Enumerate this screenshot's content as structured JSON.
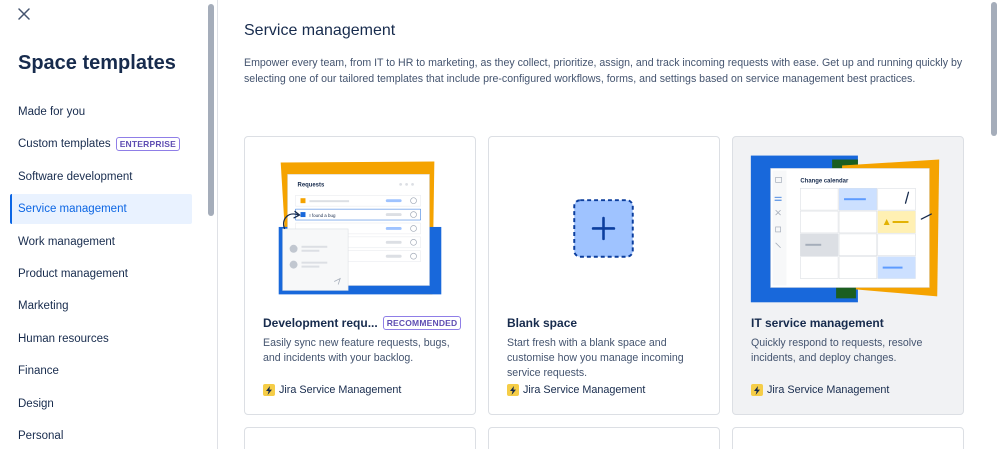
{
  "sidebar": {
    "title": "Space templates",
    "items": [
      {
        "label": "Made for you"
      },
      {
        "label": "Custom templates",
        "badge": "ENTERPRISE"
      },
      {
        "label": "Software development"
      },
      {
        "label": "Service management",
        "active": true
      },
      {
        "label": "Work management"
      },
      {
        "label": "Product management"
      },
      {
        "label": "Marketing"
      },
      {
        "label": "Human resources"
      },
      {
        "label": "Finance"
      },
      {
        "label": "Design"
      },
      {
        "label": "Personal"
      }
    ]
  },
  "main": {
    "title": "Service management",
    "description": "Empower every team, from IT to HR to marketing, as they collect, prioritize, assign, and track incoming requests with ease. Get up and running quickly by selecting one of our tailored templates that include pre-configured workflows, forms, and settings based on service management best practices.",
    "cards": [
      {
        "title": "Development requ...",
        "badge": "RECOMMENDED",
        "description": "Easily sync new feature requests, bugs, and incidents with your backlog.",
        "product": "Jira Service Management",
        "illustration": {
          "heading": "Requests",
          "row_label": "I found a bug"
        }
      },
      {
        "title": "Blank space",
        "description": "Start fresh with a blank space and customise how you manage incoming service requests.",
        "product": "Jira Service Management"
      },
      {
        "title": "IT service management",
        "description": "Quickly respond to requests, resolve incidents, and deploy changes.",
        "product": "Jira Service Management",
        "illustration": {
          "heading": "Change calendar"
        }
      }
    ]
  },
  "colors": {
    "accent": "#0c66e4",
    "active_bg": "#e9f2ff",
    "lozenge_purple": "#5e4db2",
    "illus_orange": "#f5a300",
    "illus_blue": "#1868db",
    "blank_tile": "#9fc3ff",
    "jsm_yellow": "#f5cd47"
  },
  "icons": {
    "close": "close-icon",
    "plus": "plus-icon",
    "product": "lightning-bolt-icon"
  }
}
